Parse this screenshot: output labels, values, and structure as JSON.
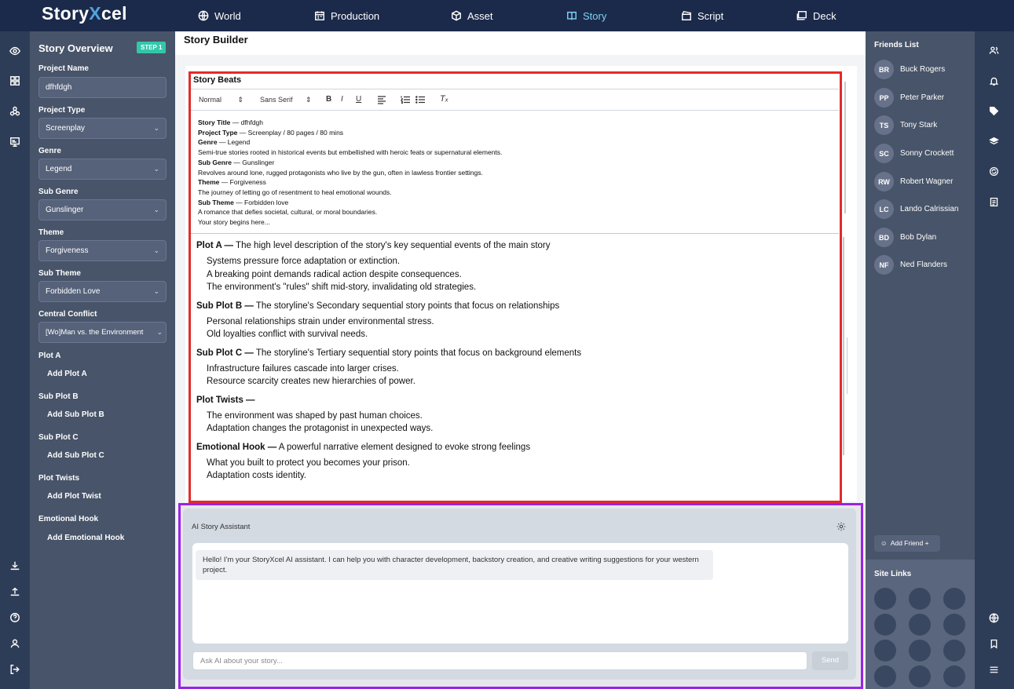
{
  "brand": {
    "name_pre": "Story",
    "name_x": "X",
    "name_post": "cel"
  },
  "nav": [
    "World",
    "Production",
    "Asset",
    "Story",
    "Script",
    "Deck"
  ],
  "sidebar": {
    "title": "Story Overview",
    "step": "STEP 1",
    "fields": [
      {
        "label": "Project Name",
        "value": "dfhfdgh"
      },
      {
        "label": "Project Type",
        "value": "Screenplay"
      },
      {
        "label": "Genre",
        "value": "Legend"
      },
      {
        "label": "Sub Genre",
        "value": "Gunslinger"
      },
      {
        "label": "Theme",
        "value": "Forgiveness"
      },
      {
        "label": "Sub Theme",
        "value": "Forbidden Love"
      },
      {
        "label": "Central Conflict",
        "value": "[Wo]Man vs. the Environment"
      }
    ],
    "adds": [
      {
        "label": "Plot A",
        "button": "Add Plot A"
      },
      {
        "label": "Sub Plot B",
        "button": "Add Sub Plot B"
      },
      {
        "label": "Sub Plot C",
        "button": "Add Sub Plot C"
      },
      {
        "label": "Plot Twists",
        "button": "Add Plot Twist"
      },
      {
        "label": "Emotional Hook",
        "button": "Add Emotional Hook"
      }
    ]
  },
  "main": {
    "title": "Story Builder",
    "beats_title": "Story Beats",
    "toolbar": {
      "format": "Normal",
      "font": "Sans Serif",
      "bold": "B",
      "italic": "I",
      "underline": "U",
      "clear": "Tₓ"
    },
    "preview": [
      {
        "k": "Story Title",
        "v": " — dfhfdgh"
      },
      {
        "k": "Project Type",
        "v": " — Screenplay / 80 pages / 80 mins"
      },
      {
        "k": "Genre",
        "v": " — Legend"
      },
      {
        "k": "",
        "v": "Semi-true stories rooted in historical events but embellished with heroic feats or supernatural elements."
      },
      {
        "k": "Sub Genre",
        "v": " — Gunslinger"
      },
      {
        "k": "",
        "v": "Revolves around lone, rugged protagonists who live by the gun, often in lawless frontier settings."
      },
      {
        "k": "Theme",
        "v": " — Forgiveness"
      },
      {
        "k": "",
        "v": "The journey of letting go of resentment to heal emotional wounds."
      },
      {
        "k": "Sub Theme",
        "v": " — Forbidden love"
      },
      {
        "k": "",
        "v": "A romance that defies societal, cultural, or moral boundaries."
      },
      {
        "k": "",
        "v": "Your story begins here..."
      }
    ],
    "sections": [
      {
        "heading": "Plot A —",
        "desc": " The high level description of the story's key sequential events of the main story",
        "lines": [
          "Systems pressure force adaptation or extinction.",
          "A breaking point demands radical action despite consequences.",
          "The environment's \"rules\" shift mid-story, invalidating old strategies."
        ]
      },
      {
        "heading": "Sub Plot B —",
        "desc": " The storyline's Secondary sequential story points that focus on relationships",
        "lines": [
          "Personal relationships strain under environmental stress.",
          "Old loyalties conflict with survival needs."
        ]
      },
      {
        "heading": "Sub Plot C —",
        "desc": " The storyline's Tertiary sequential story points that focus on background elements",
        "lines": [
          "Infrastructure failures cascade into larger crises.",
          "Resource scarcity creates new hierarchies of power."
        ]
      },
      {
        "heading": "Plot Twists —",
        "desc": "",
        "lines": [
          "The environment was shaped by past human choices.",
          "Adaptation changes the protagonist in unexpected ways."
        ]
      },
      {
        "heading": "Emotional Hook —",
        "desc": " A powerful narrative element designed to evoke strong feelings",
        "lines": [
          "What you built to protect you becomes your prison.",
          "Adaptation costs identity."
        ]
      }
    ]
  },
  "ai": {
    "title": "AI Story Assistant",
    "message": "Hello! I'm your StoryXcel AI assistant. I can help you with character development, backstory creation, and creative writing suggestions for your western project.",
    "placeholder": "Ask AI about your story...",
    "send": "Send"
  },
  "friends": {
    "title": "Friends List",
    "list": [
      {
        "initials": "BR",
        "name": "Buck Rogers"
      },
      {
        "initials": "PP",
        "name": "Peter Parker"
      },
      {
        "initials": "TS",
        "name": "Tony Stark"
      },
      {
        "initials": "SC",
        "name": "Sonny Crockett"
      },
      {
        "initials": "RW",
        "name": "Robert Wagner"
      },
      {
        "initials": "LC",
        "name": "Lando Calrissian"
      },
      {
        "initials": "BD",
        "name": "Bob Dylan"
      },
      {
        "initials": "NF",
        "name": "Ned Flanders"
      }
    ],
    "add": "Add Friend +"
  },
  "site_links": {
    "title": "Site Links"
  },
  "colors": {
    "topbar": "#1b2a4a",
    "sidebar": "#475469",
    "accent": "#33c7a8",
    "active_nav": "#7fd3f7",
    "highlight_red": "#e32a2a",
    "highlight_purple": "#9a23e6"
  }
}
